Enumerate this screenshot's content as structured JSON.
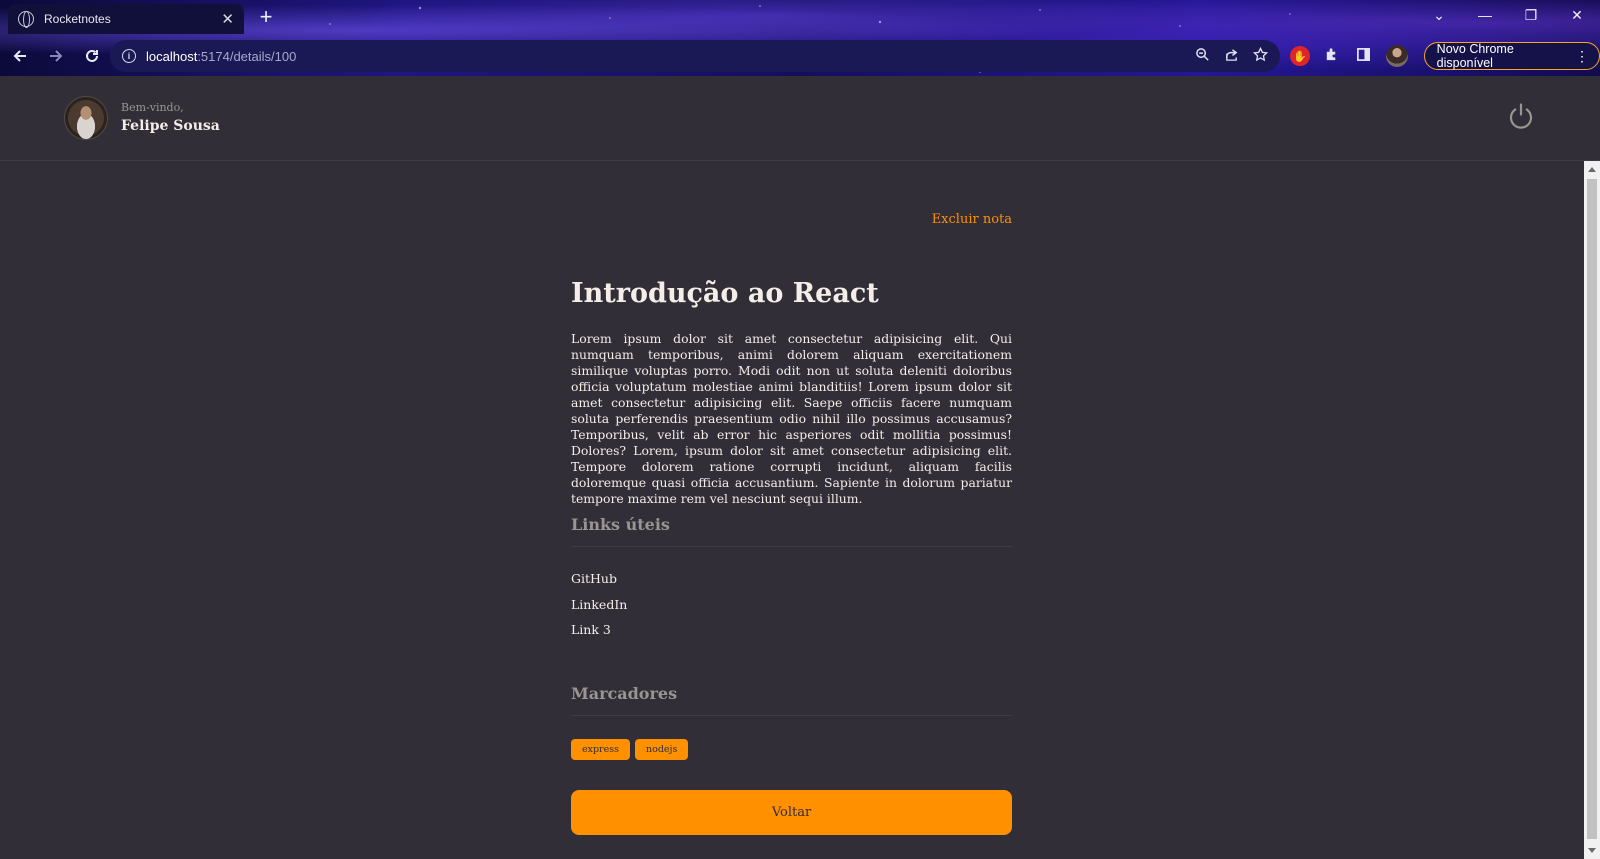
{
  "browser": {
    "tab_title": "Rocketnotes",
    "tab_close": "✕",
    "new_tab": "+",
    "url_host": "localhost",
    "url_path": ":5174/details/100",
    "update_button": "Novo Chrome disponível",
    "window_controls": [
      "⌄",
      "—",
      "❐",
      "✕"
    ]
  },
  "header": {
    "welcome": "Bem-vindo,",
    "user_name": "Felipe Sousa"
  },
  "note": {
    "delete_label": "Excluir nota",
    "title": "Introdução ao React",
    "body": "Lorem ipsum dolor sit amet consectetur adipisicing elit. Qui numquam temporibus, animi dolorem aliquam exercitationem similique voluptas porro. Modi odit non ut soluta deleniti doloribus officia voluptatum molestiae animi blanditiis! Lorem ipsum dolor sit amet consectetur adipisicing elit. Saepe officiis facere numquam soluta perferendis praesentium odio nihil illo possimus accusamus? Temporibus, velit ab error hic asperiores odit mollitia possimus! Dolores? Lorem, ipsum dolor sit amet consectetur adipisicing elit. Tempore dolorem ratione corrupti incidunt, aliquam facilis doloremque quasi officia accusantium. Sapiente in dolorum pariatur tempore maxime rem vel nesciunt sequi illum.",
    "links_title": "Links úteis",
    "links": [
      "GitHub",
      "LinkedIn",
      "Link 3"
    ],
    "tags_title": "Marcadores",
    "tags": [
      "express",
      "nodejs"
    ],
    "back_label": "Voltar"
  },
  "colors": {
    "background": "#312e38",
    "accent": "#ff9000",
    "text": "#f4ede8",
    "muted": "#999591"
  }
}
